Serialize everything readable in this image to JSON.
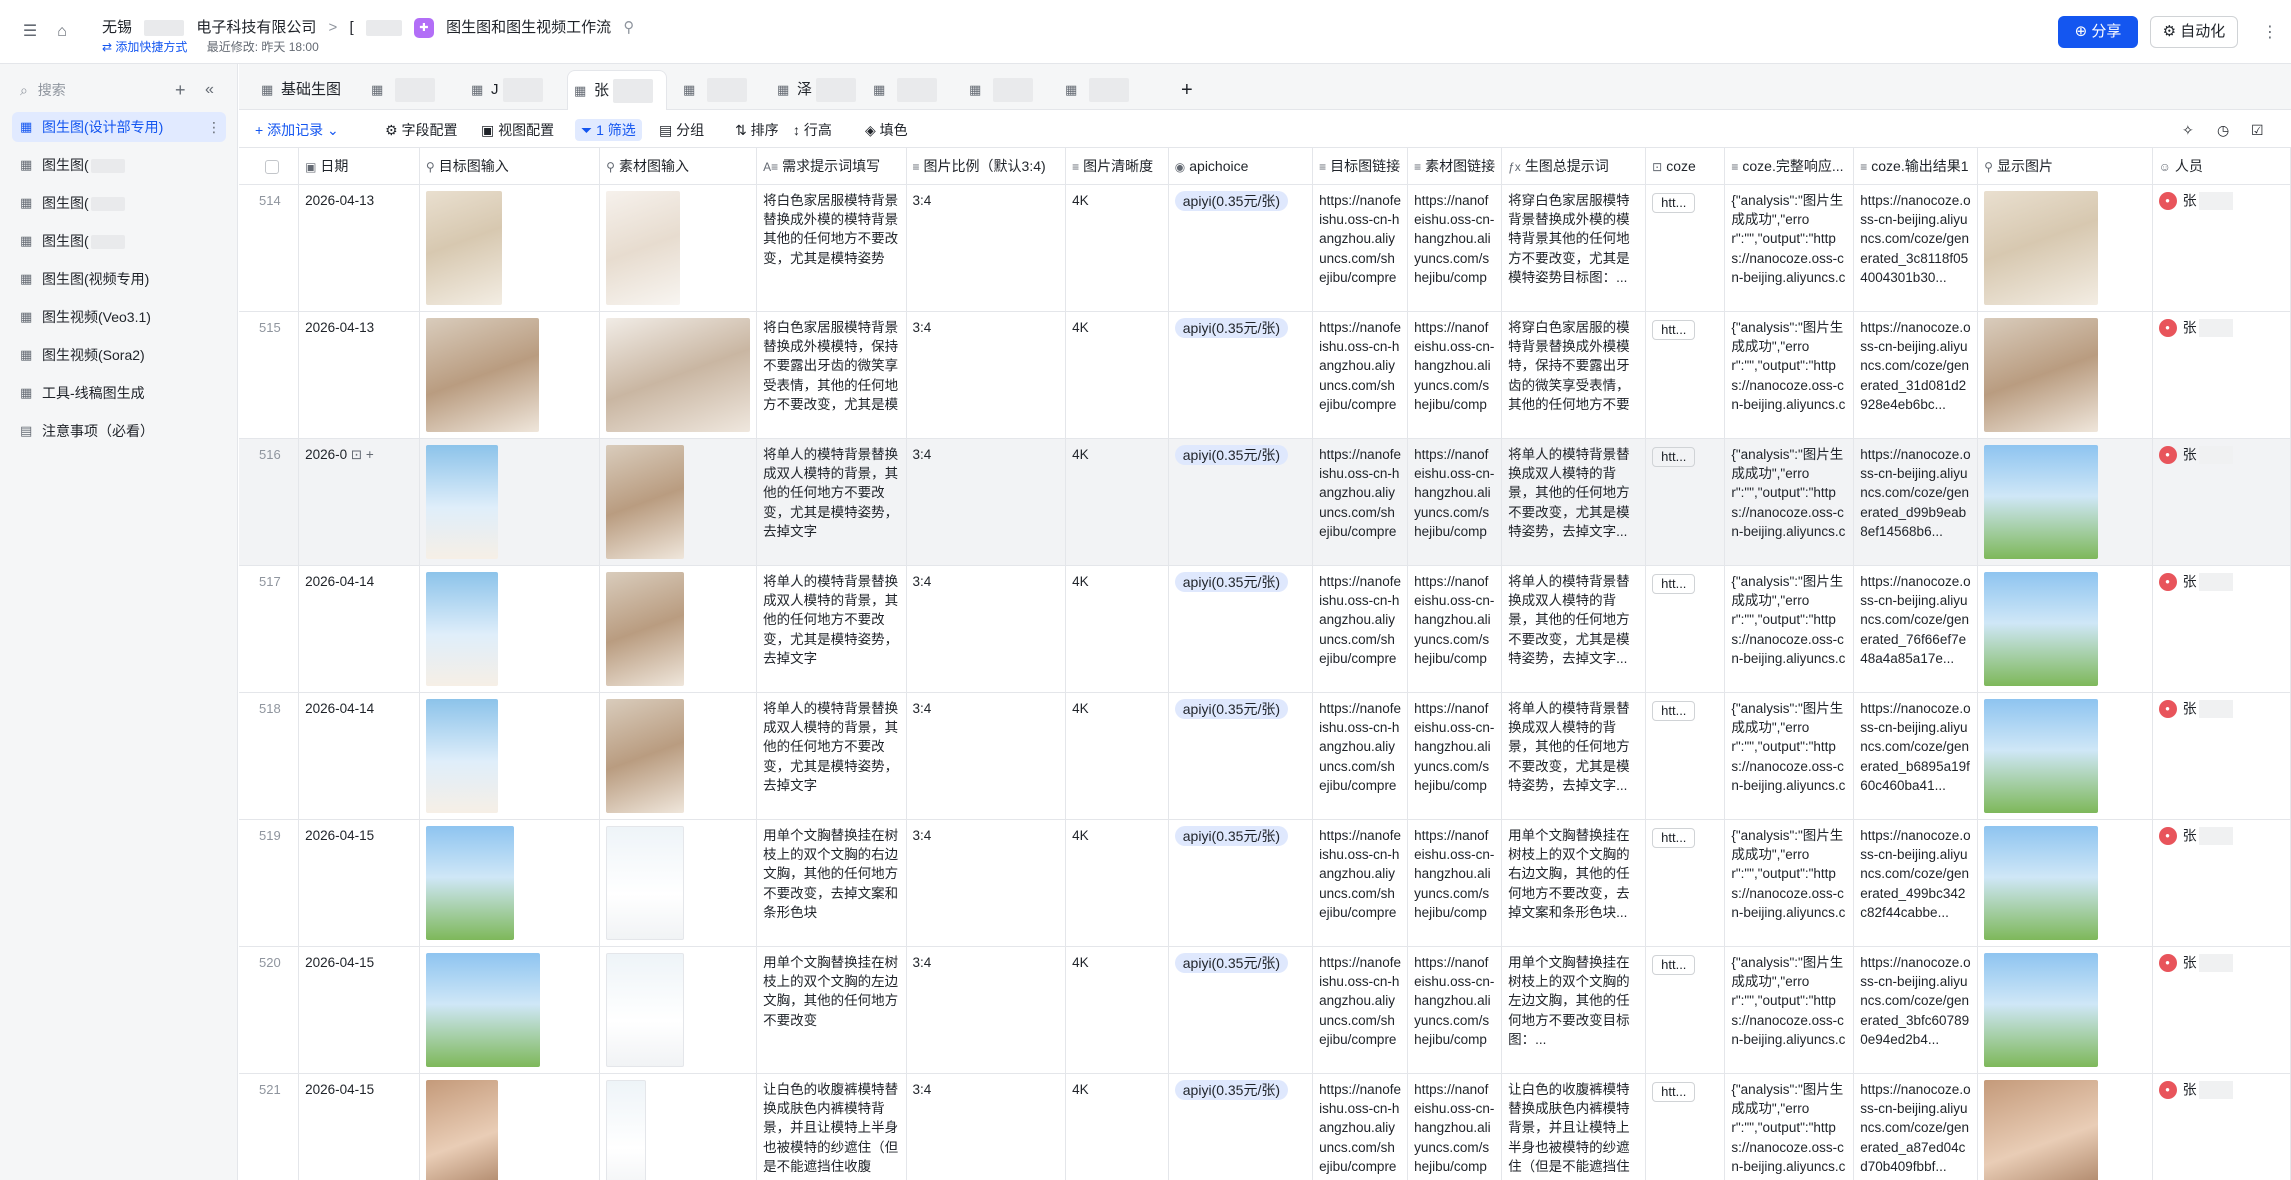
{
  "topbar": {
    "org": "无锡",
    "company": "电子科技有限公司",
    "crumb_sep": ">",
    "crumb_mid": "[",
    "app_title": "图生图和图生视频工作流",
    "add_shortcut": "添加快捷方式",
    "last_modified": "最近修改: 昨天 18:00",
    "share_label": "分享",
    "automate_label": "自动化"
  },
  "sidebar": {
    "search_placeholder": "搜索",
    "items": [
      {
        "label": "图生图(设计部专用)",
        "active": true
      },
      {
        "label": "图生图("
      },
      {
        "label": "图生图("
      },
      {
        "label": "图生图("
      },
      {
        "label": "图生图(视频专用)"
      },
      {
        "label": "图生视频(Veo3.1)"
      },
      {
        "label": "图生视频(Sora2)"
      },
      {
        "label": "工具-线稿图生成"
      },
      {
        "label": "注意事项（必看）"
      }
    ]
  },
  "tabs": [
    {
      "label": "基础生图"
    },
    {
      "label": ""
    },
    {
      "label": "J"
    },
    {
      "label": "张",
      "active": true
    },
    {
      "label": ""
    },
    {
      "label": "泽"
    },
    {
      "label": ""
    },
    {
      "label": ""
    },
    {
      "label": ""
    }
  ],
  "toolbar": {
    "add_record": "添加记录",
    "field_config": "字段配置",
    "view_config": "视图配置",
    "filter": "1 筛选",
    "group": "分组",
    "sort": "排序",
    "row_height": "行高",
    "fill_color": "填色"
  },
  "columns": [
    "日期",
    "目标图输入",
    "素材图输入",
    "需求提示词填写",
    "图片比例（默认3:4)",
    "图片清晰度",
    "apichoice",
    "目标图链接",
    "素材图链接",
    "生图总提示词",
    "coze",
    "coze.完整响应...",
    "coze.输出结果1",
    "显示图片",
    "人员"
  ],
  "rows": [
    {
      "num": "514",
      "date": "2026-04-13",
      "prompt": "将白色家居服模特背景替换成外模的模特背景其他的任何地方不要改变，尤其是模特姿势",
      "ratio": "3:4",
      "res": "4K",
      "api": "apiyi(0.35元/张)",
      "target_link": "https://nanofeishu.oss-cn-hangzhou.aliyuncs.com/shejibu/compress...",
      "src_link": "https://nanofeishu.oss-cn-hangzhou.aliyuncs.com/shejibu/compr...",
      "gen_prompt": "将穿白色家居服模特背景替换成外模的模特背景其他的任何地方不要改变，尤其是模特姿势目标图：...",
      "coze": "htt...",
      "resp": "{\"analysis\":\"图片生成成功\",\"error\":\"\",\"output\":\"https://nanocoze.oss-cn-beijing.aliyuncs.co...",
      "out": "https://nanocoze.oss-cn-beijing.aliyuncs.com/coze/generated_3c8118f054004301b30...",
      "person": "张"
    },
    {
      "num": "515",
      "date": "2026-04-13",
      "prompt": "将白色家居服模特背景替换成外模模特，保持不要露出牙齿的微笑享受表情，其他的任何地方不要改变，尤其是模特姿势",
      "ratio": "3:4",
      "res": "4K",
      "api": "apiyi(0.35元/张)",
      "target_link": "https://nanofeishu.oss-cn-hangzhou.aliyuncs.com/shejibu/compress...",
      "src_link": "https://nanofeishu.oss-cn-hangzhou.aliyuncs.com/shejibu/compr...",
      "gen_prompt": "将穿白色家居服的模特背景替换成外模模特，保持不要露出牙齿的微笑享受表情，其他的任何地方不要改变，尤其是...",
      "coze": "htt...",
      "resp": "{\"analysis\":\"图片生成成功\",\"error\":\"\",\"output\":\"https://nanocoze.oss-cn-beijing.aliyuncs.co...",
      "out": "https://nanocoze.oss-cn-beijing.aliyuncs.com/coze/generated_31d081d2928e4eb6bc...",
      "person": "张"
    },
    {
      "num": "516",
      "date": "2026-0",
      "prompt": "将单人的模特背景替换成双人模特的背景，其他的任何地方不要改变，尤其是模特姿势，去掉文字",
      "ratio": "3:4",
      "res": "4K",
      "api": "apiyi(0.35元/张)",
      "target_link": "https://nanofeishu.oss-cn-hangzhou.aliyuncs.com/shejibu/compress...",
      "src_link": "https://nanofeishu.oss-cn-hangzhou.aliyuncs.com/shejibu/compr...",
      "gen_prompt": "将单人的模特背景替换成双人模特的背景，其他的任何地方不要改变，尤其是模特姿势，去掉文字...",
      "coze": "htt...",
      "resp": "{\"analysis\":\"图片生成成功\",\"error\":\"\",\"output\":\"https://nanocoze.oss-cn-beijing.aliyuncs.co...",
      "out": "https://nanocoze.oss-cn-beijing.aliyuncs.com/coze/generated_d99b9eab8ef14568b6...",
      "person": "张"
    },
    {
      "num": "517",
      "date": "2026-04-14",
      "prompt": "将单人的模特背景替换成双人模特的背景，其他的任何地方不要改变，尤其是模特姿势，去掉文字",
      "ratio": "3:4",
      "res": "4K",
      "api": "apiyi(0.35元/张)",
      "target_link": "https://nanofeishu.oss-cn-hangzhou.aliyuncs.com/shejibu/compress...",
      "src_link": "https://nanofeishu.oss-cn-hangzhou.aliyuncs.com/shejibu/compr...",
      "gen_prompt": "将单人的模特背景替换成双人模特的背景，其他的任何地方不要改变，尤其是模特姿势，去掉文字...",
      "coze": "htt...",
      "resp": "{\"analysis\":\"图片生成成功\",\"error\":\"\",\"output\":\"https://nanocoze.oss-cn-beijing.aliyuncs.co...",
      "out": "https://nanocoze.oss-cn-beijing.aliyuncs.com/coze/generated_76f66ef7e48a4a85a17e...",
      "person": "张"
    },
    {
      "num": "518",
      "date": "2026-04-14",
      "prompt": "将单人的模特背景替换成双人模特的背景，其他的任何地方不要改变，尤其是模特姿势，去掉文字",
      "ratio": "3:4",
      "res": "4K",
      "api": "apiyi(0.35元/张)",
      "target_link": "https://nanofeishu.oss-cn-hangzhou.aliyuncs.com/shejibu/compress...",
      "src_link": "https://nanofeishu.oss-cn-hangzhou.aliyuncs.com/shejibu/compr...",
      "gen_prompt": "将单人的模特背景替换成双人模特的背景，其他的任何地方不要改变，尤其是模特姿势，去掉文字...",
      "coze": "htt...",
      "resp": "{\"analysis\":\"图片生成成功\",\"error\":\"\",\"output\":\"https://nanocoze.oss-cn-beijing.aliyuncs.co...",
      "out": "https://nanocoze.oss-cn-beijing.aliyuncs.com/coze/generated_b6895a19f60c460ba41...",
      "person": "张"
    },
    {
      "num": "519",
      "date": "2026-04-15",
      "prompt": "用单个文胸替换挂在树枝上的双个文胸的右边文胸，其他的任何地方不要改变，去掉文案和条形色块",
      "ratio": "3:4",
      "res": "4K",
      "api": "apiyi(0.35元/张)",
      "target_link": "https://nanofeishu.oss-cn-hangzhou.aliyuncs.com/shejibu/compress...",
      "src_link": "https://nanofeishu.oss-cn-hangzhou.aliyuncs.com/shejibu/compr...",
      "gen_prompt": "用单个文胸替换挂在树枝上的双个文胸的右边文胸，其他的任何地方不要改变，去掉文案和条形色块...",
      "coze": "htt...",
      "resp": "{\"analysis\":\"图片生成成功\",\"error\":\"\",\"output\":\"https://nanocoze.oss-cn-beijing.aliyuncs.co...",
      "out": "https://nanocoze.oss-cn-beijing.aliyuncs.com/coze/generated_499bc342c82f44cabbe...",
      "person": "张"
    },
    {
      "num": "520",
      "date": "2026-04-15",
      "prompt": "用单个文胸替换挂在树枝上的双个文胸的左边文胸，其他的任何地方不要改变",
      "ratio": "3:4",
      "res": "4K",
      "api": "apiyi(0.35元/张)",
      "target_link": "https://nanofeishu.oss-cn-hangzhou.aliyuncs.com/shejibu/compress...",
      "src_link": "https://nanofeishu.oss-cn-hangzhou.aliyuncs.com/shejibu/compr...",
      "gen_prompt": "用单个文胸替换挂在树枝上的双个文胸的左边文胸，其他的任何地方不要改变目标图：...",
      "coze": "htt...",
      "resp": "{\"analysis\":\"图片生成成功\",\"error\":\"\",\"output\":\"https://nanocoze.oss-cn-beijing.aliyuncs.co...",
      "out": "https://nanocoze.oss-cn-beijing.aliyuncs.com/coze/generated_3bfc607890e94ed2b4...",
      "person": "张"
    },
    {
      "num": "521",
      "date": "2026-04-15",
      "prompt": "让白色的收腹裤模特替换成肤色内裤模特背景，并且让模特上半身也被模特的纱遮住（但是不能遮挡住收腹裤），不要漏...",
      "ratio": "3:4",
      "res": "4K",
      "api": "apiyi(0.35元/张)",
      "target_link": "https://nanofeishu.oss-cn-hangzhou.aliyuncs.com/shejibu/compress...",
      "src_link": "https://nanofeishu.oss-cn-hangzhou.aliyuncs.com/shejibu/compr...",
      "gen_prompt": "让白色的收腹裤模特替换成肤色内裤模特背景，并且让模特上半身也被模特的纱遮住（但是不能遮挡住收腹裤...",
      "coze": "htt...",
      "resp": "{\"analysis\":\"图片生成成功\",\"error\":\"\",\"output\":\"https://nanocoze.oss-cn-beijing.aliyuncs.co...",
      "out": "https://nanocoze.oss-cn-beijing.aliyuncs.com/coze/generated_a87ed04cd70b409fbbf...",
      "person": "张"
    }
  ]
}
